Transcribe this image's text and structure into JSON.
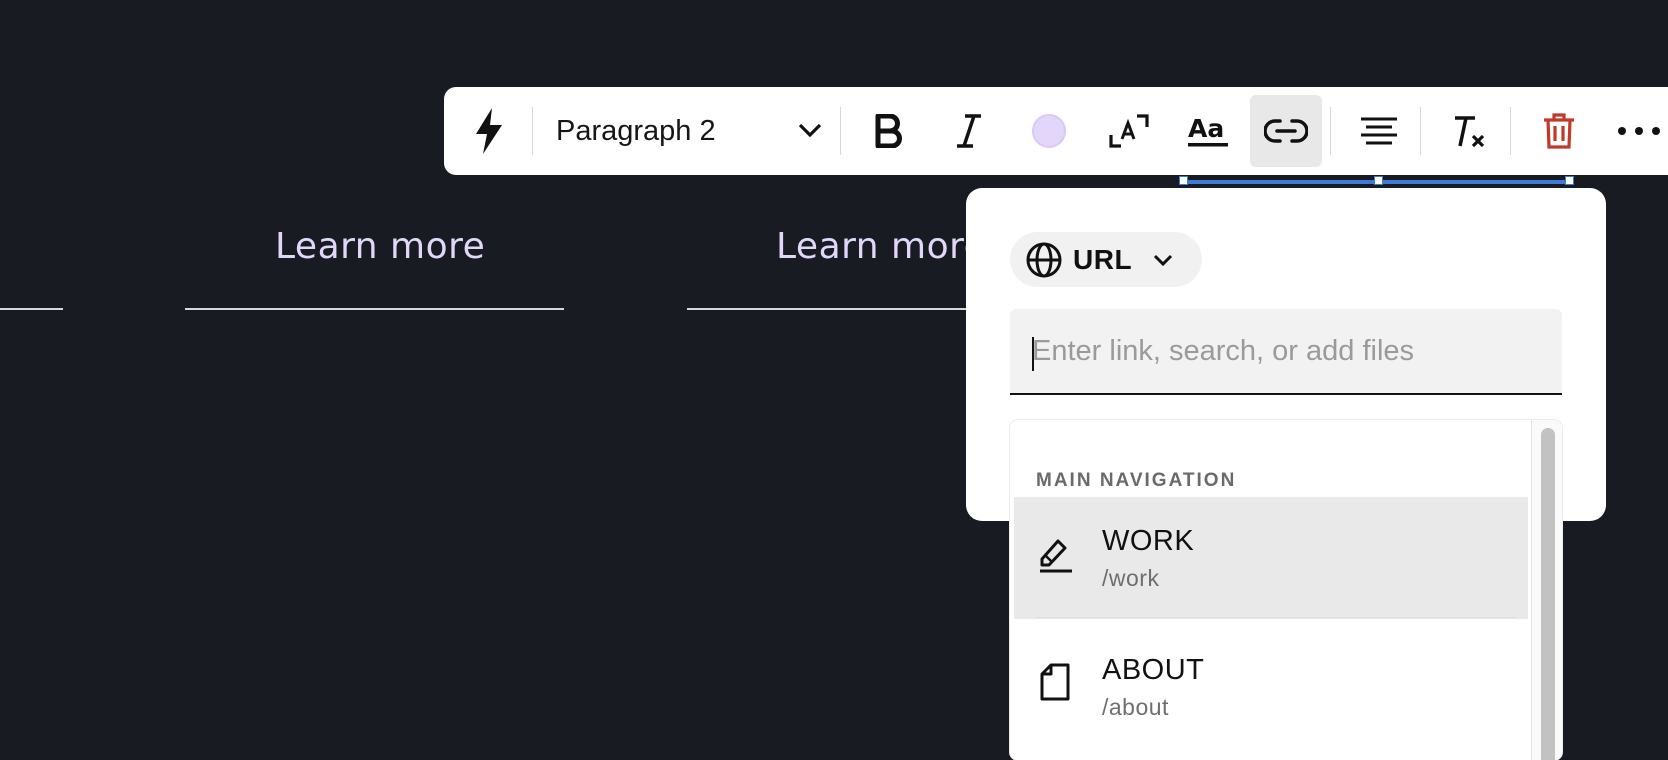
{
  "page": {
    "learn_more_1": "Learn more",
    "learn_more_2": "Learn more"
  },
  "toolbar": {
    "block_type": "Paragraph 2",
    "buttons": [
      "quick-actions",
      "bold",
      "italic",
      "text-color",
      "text-size",
      "text-style",
      "link",
      "align",
      "clear-formatting",
      "delete",
      "more"
    ],
    "text_color_swatch": "#e2d6fb",
    "delete_color": "#c0392b"
  },
  "link_popover": {
    "link_type": "URL",
    "input_placeholder": "Enter link, search, or add files",
    "input_value": "",
    "section_label": "MAIN NAVIGATION",
    "items": [
      {
        "title": "WORK",
        "path": "/work",
        "icon": "edit-pen-icon"
      },
      {
        "title": "ABOUT",
        "path": "/about",
        "icon": "page-icon"
      }
    ]
  },
  "colors": {
    "background": "#181b21",
    "accent_text": "#e2d6fb",
    "selection": "#3d7bd6"
  }
}
